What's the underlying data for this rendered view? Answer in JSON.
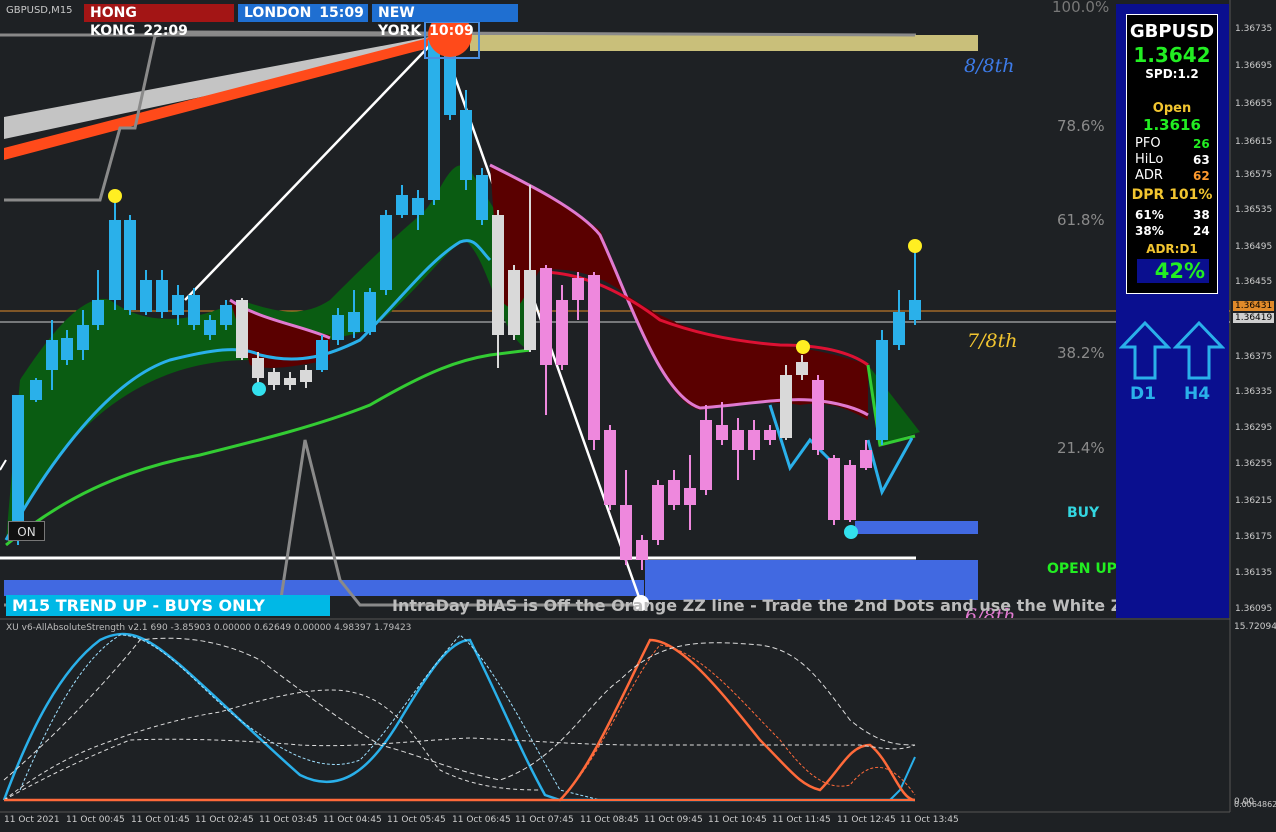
{
  "symbol_tf": "GBPUSD,M15",
  "sessions": [
    {
      "name": "HONG KONG",
      "time": "22:09",
      "bg": "#a31515"
    },
    {
      "name": "LONDON",
      "time": "15:09",
      "bg": "#1f6fd1"
    },
    {
      "name": "NEW YORK",
      "time": "10:09",
      "bg": "#1f6fd1"
    }
  ],
  "fib_levels": [
    {
      "label": "100.0%",
      "color": "#777777"
    },
    {
      "label": "78.6%",
      "color": "#8a8a8a"
    },
    {
      "label": "61.8%",
      "color": "#8a8a8a"
    },
    {
      "label": "38.2%",
      "color": "#8a8a8a"
    },
    {
      "label": "21.4%",
      "color": "#8a8a8a"
    }
  ],
  "murrey": [
    {
      "label": "8/8th",
      "color": "#3d7be8"
    },
    {
      "label": "7/8th",
      "color": "#f2c530"
    },
    {
      "label": "6/8th",
      "color": "#e07ad0"
    }
  ],
  "signals": {
    "buy": "BUY",
    "buy_color": "#33d6e0",
    "open_up": "OPEN UP",
    "open_up_color": "#22ee22"
  },
  "on_button": "ON",
  "trend_banner": "M15 TREND UP - BUYS ONLY",
  "bias_text": "IntraDay BIAS is Off the Orange ZZ line - Trade the 2nd Dots and use the White Z",
  "price_axis": [
    "1.36735",
    "1.36695",
    "1.36655",
    "1.36615",
    "1.36575",
    "1.36535",
    "1.36495",
    "1.36455",
    "1.36431",
    "1.36419",
    "1.36375",
    "1.36335",
    "1.36295",
    "1.36255",
    "1.36215",
    "1.36175",
    "1.36135",
    "1.36095"
  ],
  "indicator": {
    "header": "XU v6-AllAbsoluteStrength  v2.1 690 -3.85903 0.00000 0.62649 0.00000 4.98397 1.79423",
    "axis_top": "15.72094",
    "axis_bottom": "0.0064862",
    "axis_bottom_prefix": "0.00"
  },
  "time_axis": [
    "11 Oct 2021",
    "11 Oct 00:45",
    "11 Oct 01:45",
    "11 Oct 02:45",
    "11 Oct 03:45",
    "11 Oct 04:45",
    "11 Oct 05:45",
    "11 Oct 06:45",
    "11 Oct 07:45",
    "11 Oct 08:45",
    "11 Oct 09:45",
    "11 Oct 10:45",
    "11 Oct 11:45",
    "11 Oct 12:45",
    "11 Oct 13:45"
  ],
  "dashboard": {
    "symbol": "GBPUSD",
    "price": "1.3642",
    "spread": "SPD:1.2",
    "open_label": "Open",
    "open_value": "1.3616",
    "stats": [
      {
        "label": "PFO",
        "value": "26",
        "color": "#22ee22"
      },
      {
        "label": "HiLo",
        "value": "63",
        "color": "#ffffff"
      },
      {
        "label": "ADR",
        "value": "62",
        "color": "#ff9a2e"
      }
    ],
    "dpr": "DPR 101%",
    "fib_rows": [
      {
        "label": "61%",
        "value": "38"
      },
      {
        "label": "38%",
        "value": "24"
      }
    ],
    "adr_d1": "ADR:D1",
    "adr_pct": "42%",
    "arrows": [
      {
        "label": "D1",
        "direction": "up"
      },
      {
        "label": "H4",
        "direction": "up"
      }
    ]
  }
}
